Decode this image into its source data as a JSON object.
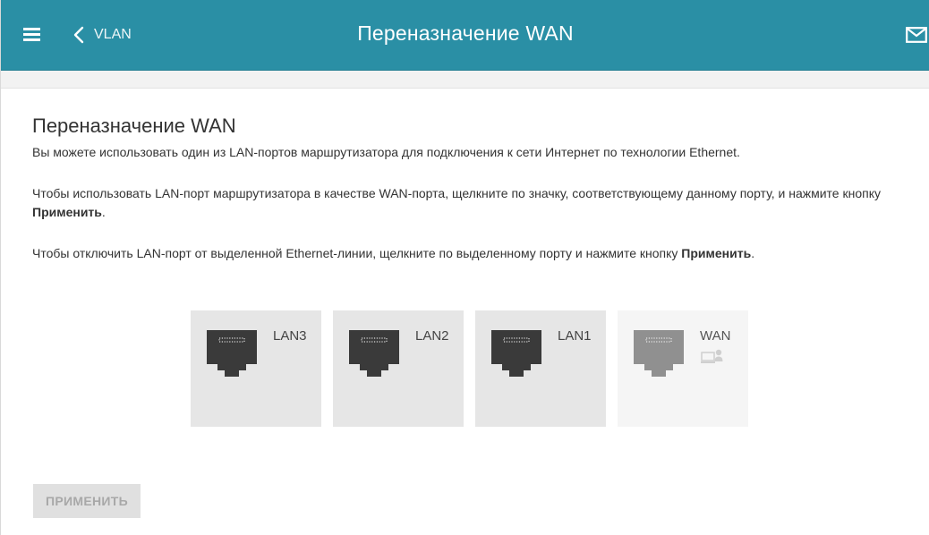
{
  "header": {
    "back_label": "VLAN",
    "title": "Переназначение WAN",
    "icons": [
      "menu-icon",
      "chevron-left-icon",
      "mail-icon"
    ]
  },
  "section": {
    "title": "Переназначение WAN",
    "paragraph_1": "Вы можете использовать один из LAN-портов маршрутизатора для подключения к сети Интернет по технологии Ethernet.",
    "paragraph_2_prefix": "Чтобы использовать LAN-порт маршрутизатора в качестве WAN-порта, щелкните по значку, соответствующему данному порту, и нажмите кнопку ",
    "paragraph_2_bold": "Применить",
    "paragraph_2_suffix": ".",
    "paragraph_3_prefix": "Чтобы отключить LAN-порт от выделенной Ethernet-линии, щелкните по выделенному порту и нажмите кнопку ",
    "paragraph_3_bold": "Применить",
    "paragraph_3_suffix": "."
  },
  "ports": [
    {
      "label": "LAN3",
      "state": "active",
      "icon": "ethernet-port-icon"
    },
    {
      "label": "LAN2",
      "state": "active",
      "icon": "ethernet-port-icon"
    },
    {
      "label": "LAN1",
      "state": "active",
      "icon": "ethernet-port-icon"
    },
    {
      "label": "WAN",
      "state": "dimmed",
      "icon": "ethernet-port-icon",
      "extra_icon": "computer-user-icon"
    }
  ],
  "actions": {
    "apply_label": "ПРИМЕНИТЬ",
    "apply_enabled": false
  },
  "colors": {
    "header_bg": "#2a8fa5",
    "port_card_bg": "#e6e6e6",
    "wan_card_bg": "#f5f5f5",
    "port_icon_dark": "#3a3a3a",
    "port_icon_dimmed": "#909090",
    "button_disabled_bg": "#e0e0e0"
  }
}
